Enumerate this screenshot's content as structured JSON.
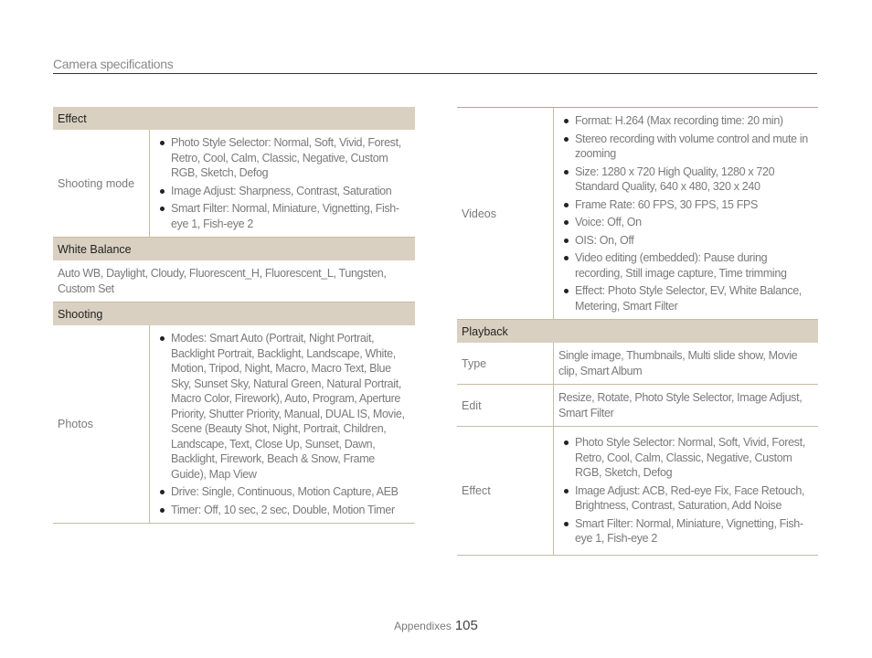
{
  "header": {
    "title": "Camera specifications"
  },
  "left_column": {
    "effect": {
      "header": "Effect",
      "rows": [
        {
          "label": "Shooting mode",
          "items": [
            "Photo Style Selector: Normal, Soft, Vivid, Forest, Retro, Cool, Calm, Classic, Negative, Custom RGB, Sketch, Defog",
            "Image Adjust: Sharpness, Contrast, Saturation",
            "Smart Filter: Normal, Miniature, Vignetting, Fish-eye 1, Fish-eye 2"
          ]
        }
      ]
    },
    "white_balance": {
      "header": "White Balance",
      "text": "Auto WB, Daylight, Cloudy, Fluorescent_H, Fluorescent_L, Tungsten, Custom Set"
    },
    "shooting": {
      "header": "Shooting",
      "rows": [
        {
          "label": "Photos",
          "items": [
            "Modes: Smart Auto (Portrait, Night Portrait, Backlight Portrait, Backlight, Landscape, White, Motion, Tripod, Night, Macro, Macro Text, Blue Sky, Sunset Sky, Natural Green, Natural Portrait, Macro Color, Firework), Auto, Program, Aperture Priority, Shutter Priority, Manual, DUAL IS, Movie, Scene (Beauty Shot, Night, Portrait, Children, Landscape, Text, Close Up, Sunset, Dawn, Backlight, Firework, Beach & Snow, Frame Guide), Map View",
            "Drive: Single, Continuous, Motion Capture, AEB",
            "Timer: Off, 10 sec, 2 sec, Double, Motion Timer"
          ]
        }
      ]
    }
  },
  "right_column": {
    "videos": {
      "label": "Videos",
      "items": [
        "Format: H.264 (Max recording time: 20 min)",
        "Stereo recording with volume control and mute in zooming",
        "Size: 1280 x 720 High Quality, 1280 x 720 Standard Quality, 640 x 480, 320 x 240",
        "Frame Rate: 60 FPS, 30 FPS, 15 FPS",
        "Voice: Off, On",
        "OIS: On, Off",
        "Video editing (embedded): Pause during recording, Still image capture, Time trimming",
        "Effect: Photo Style Selector, EV, White Balance, Metering, Smart Filter"
      ]
    },
    "playback": {
      "header": "Playback",
      "type": {
        "label": "Type",
        "text": "Single image, Thumbnails, Multi slide show, Movie clip, Smart Album"
      },
      "edit": {
        "label": "Edit",
        "text": "Resize, Rotate, Photo Style Selector, Image Adjust, Smart Filter"
      },
      "effect": {
        "label": "Effect",
        "items": [
          "Photo Style Selector: Normal, Soft, Vivid, Forest, Retro, Cool, Calm, Classic, Negative, Custom RGB, Sketch, Defog",
          "Image Adjust: ACB, Red-eye Fix, Face Retouch, Brightness, Contrast, Saturation, Add Noise",
          "Smart Filter: Normal, Miniature, Vignetting, Fish-eye 1, Fish-eye 2"
        ]
      }
    }
  },
  "footer": {
    "section": "Appendixes",
    "page_number": "105"
  },
  "colors": {
    "section_header_bg": "#d9d0c1",
    "rule": "#c7bba4",
    "text": "#7a7a7a"
  }
}
